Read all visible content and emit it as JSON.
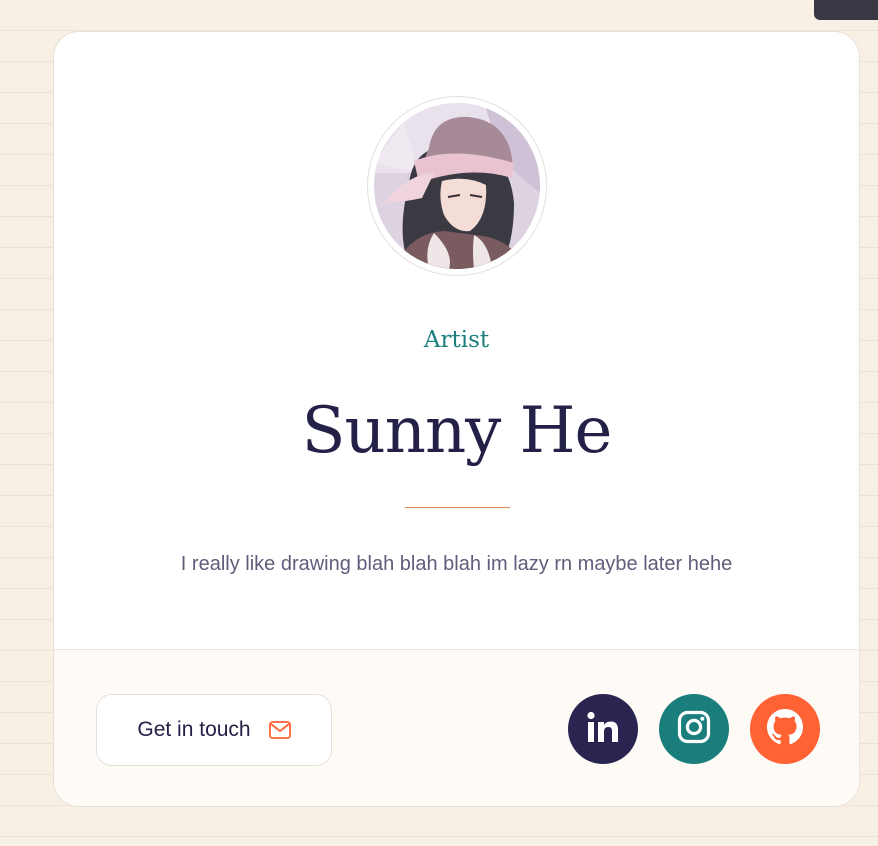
{
  "profile": {
    "role": "Artist",
    "name": "Sunny He",
    "bio": "I really like drawing blah blah blah im lazy rn maybe later hehe"
  },
  "footer": {
    "contact_label": "Get in touch",
    "contact_icon": "mail-icon",
    "social": [
      {
        "icon": "linkedin-icon",
        "color": "#292550"
      },
      {
        "icon": "instagram-icon",
        "color": "#1a7f7c"
      },
      {
        "icon": "github-icon",
        "color": "#ff6233"
      }
    ]
  },
  "colors": {
    "background": "#f8f0e5",
    "card": "#ffffff",
    "footer": "#fefaf6",
    "accent_teal": "#1d7f7d",
    "name_navy": "#242148",
    "divider_orange": "#e08a5a"
  }
}
